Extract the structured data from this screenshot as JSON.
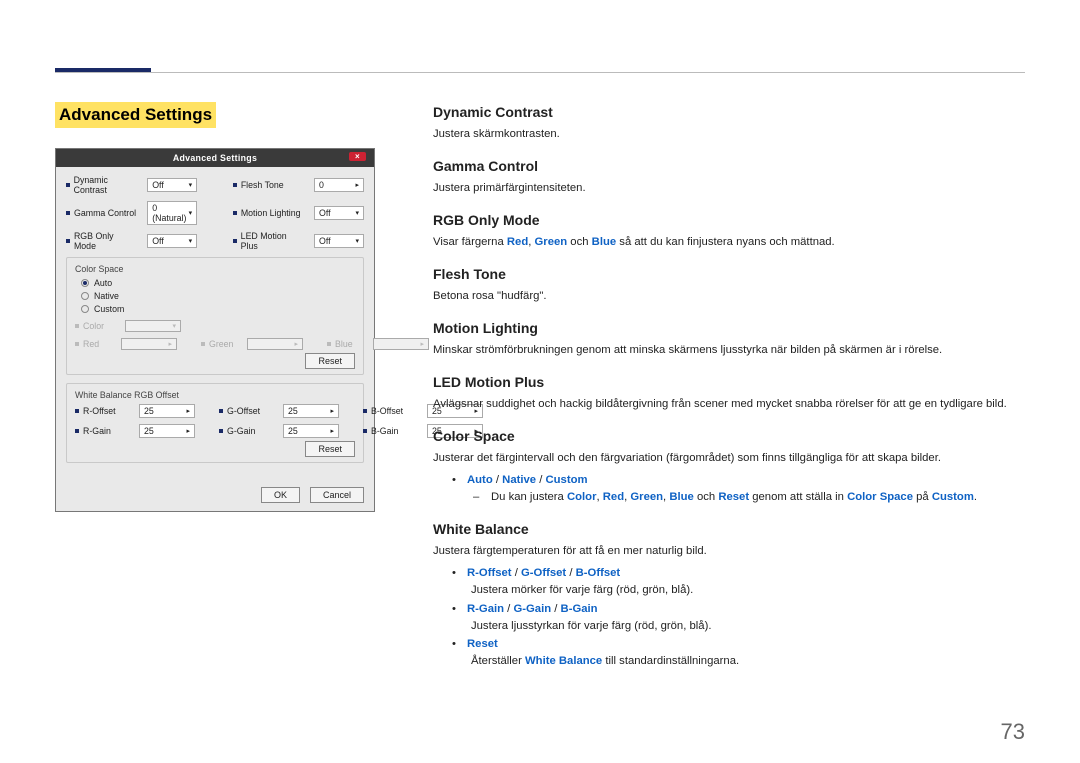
{
  "page_number": "73",
  "section_title": "Advanced Settings",
  "dialog": {
    "title": "Advanced Settings",
    "close": "×",
    "rows_left": [
      {
        "label": "Dynamic Contrast",
        "value": "Off"
      },
      {
        "label": "Gamma Control",
        "value": "0 (Natural)"
      },
      {
        "label": "RGB Only Mode",
        "value": "Off"
      }
    ],
    "rows_right": [
      {
        "label": "Flesh Tone",
        "value": "0"
      },
      {
        "label": "Motion Lighting",
        "value": "Off"
      },
      {
        "label": "LED Motion Plus",
        "value": "Off"
      }
    ],
    "cs_title": "Color Space",
    "cs_opts": [
      "Auto",
      "Native",
      "Custom"
    ],
    "cs_color_label": "Color",
    "cs_rgb": [
      "Red",
      "Green",
      "Blue"
    ],
    "wb_title": "White Balance RGB Offset",
    "wb_rows": [
      [
        {
          "l": "R-Offset",
          "v": "25"
        },
        {
          "l": "G-Offset",
          "v": "25"
        },
        {
          "l": "B-Offset",
          "v": "25"
        }
      ],
      [
        {
          "l": "R-Gain",
          "v": "25"
        },
        {
          "l": "G-Gain",
          "v": "25"
        },
        {
          "l": "B-Gain",
          "v": "25"
        }
      ]
    ],
    "reset": "Reset",
    "ok": "OK",
    "cancel": "Cancel"
  },
  "sections": {
    "dc": {
      "h": "Dynamic Contrast",
      "p": "Justera skärmkontrasten."
    },
    "gc": {
      "h": "Gamma Control",
      "p": "Justera primärfärgintensiteten."
    },
    "rgb": {
      "h": "RGB Only Mode",
      "pre": "Visar färgerna ",
      "r": "Red",
      "c1": ", ",
      "g": "Green",
      "c2": " och ",
      "b": "Blue",
      "post": " så att du kan finjustera nyans och mättnad."
    },
    "ft": {
      "h": "Flesh Tone",
      "p": "Betona rosa \"hudfärg\"."
    },
    "ml": {
      "h": "Motion Lighting",
      "p": "Minskar strömförbrukningen genom att minska skärmens ljusstyrka när bilden på skärmen är i rörelse."
    },
    "lmp": {
      "h": "LED Motion Plus",
      "p": "Avlägsnar suddighet och hackig bildåtergivning från scener med mycket snabba rörelser för att ge en tydligare bild."
    },
    "cs": {
      "h": "Color Space",
      "p": "Justerar det färgintervall och den färgvariation (färgområdet) som finns tillgängliga för att skapa bilder.",
      "li_auto": "Auto",
      "sep": " / ",
      "li_native": "Native",
      "li_custom": "Custom",
      "sub_pre": "Du kan justera ",
      "words": {
        "color": "Color",
        "red": "Red",
        "green": "Green",
        "blue": "Blue",
        "reset": "Reset",
        "colorspace": "Color Space",
        "custom": "Custom"
      },
      "sub_mid1": ", ",
      "sub_mid_och": " och ",
      "sub_between": " genom att ställa in ",
      "sub_pa": " på ",
      "sub_end": "."
    },
    "wb": {
      "h": "White Balance",
      "p": "Justera färgtemperaturen för att få en mer naturlig bild.",
      "off": {
        "r": "R-Offset",
        "g": "G-Offset",
        "b": "B-Offset",
        "desc": "Justera mörker för varje färg (röd, grön, blå)."
      },
      "gain": {
        "r": "R-Gain",
        "g": "G-Gain",
        "b": "B-Gain",
        "desc": "Justera ljusstyrkan för varje färg (röd, grön, blå)."
      },
      "reset": {
        "label": "Reset",
        "desc_pre": "Återställer ",
        "desc_wb": "White Balance",
        "desc_post": " till standardinställningarna."
      }
    }
  }
}
